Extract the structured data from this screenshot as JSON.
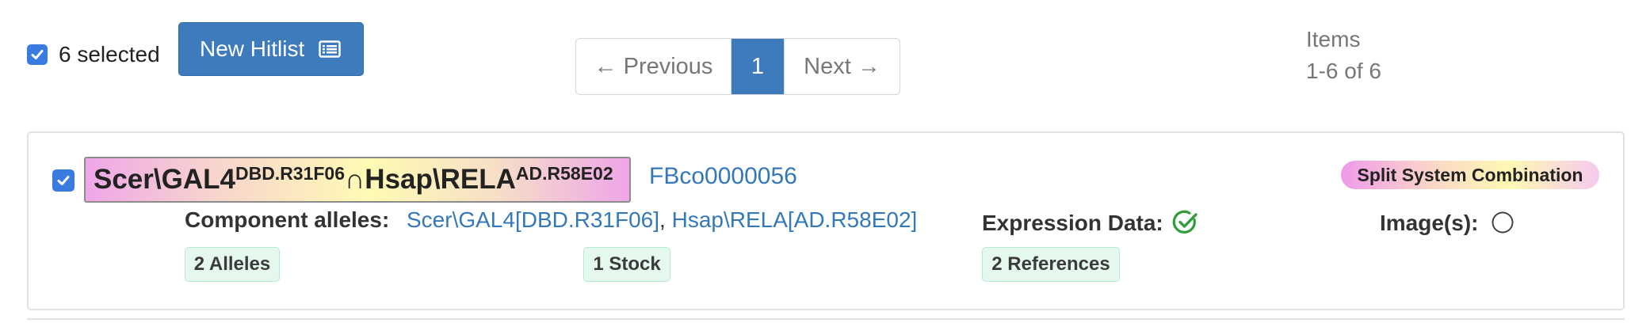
{
  "toolbar": {
    "selected_label": "6 selected",
    "new_hitlist_label": "New Hitlist",
    "new_hitlist_icon": "list-alt-icon"
  },
  "pagination": {
    "previous_label": "← Previous",
    "current_page": "1",
    "next_label": "Next →"
  },
  "items_info": {
    "label": "Items",
    "range": "1-6 of 6"
  },
  "result": {
    "symbol": {
      "part1": "Scer\\GAL4",
      "sup1": "DBD.R31F06",
      "join": "∩",
      "part2": "Hsap\\RELA",
      "sup2": "AD.R58E02"
    },
    "id": "FBco0000056",
    "type_badge": "Split System Combination",
    "component_label": "Component alleles:",
    "components": [
      "Scer\\GAL4[DBD.R31F06]",
      "Hsap\\RELA[AD.R58E02]"
    ],
    "component_separator": ",",
    "expression_label": "Expression Data:",
    "expression_icon": "check-circle-icon",
    "images_label": "Image(s):",
    "images_icon": "empty-circle-icon",
    "tags": {
      "alleles": "2 Alleles",
      "stock": "1 Stock",
      "references": "2 References"
    }
  },
  "colors": {
    "primary": "#3e7bbd",
    "checkbox": "#3a7be0",
    "link": "#3478b8",
    "success": "#2e9d3a",
    "tag_bg": "#e5f8ee"
  }
}
